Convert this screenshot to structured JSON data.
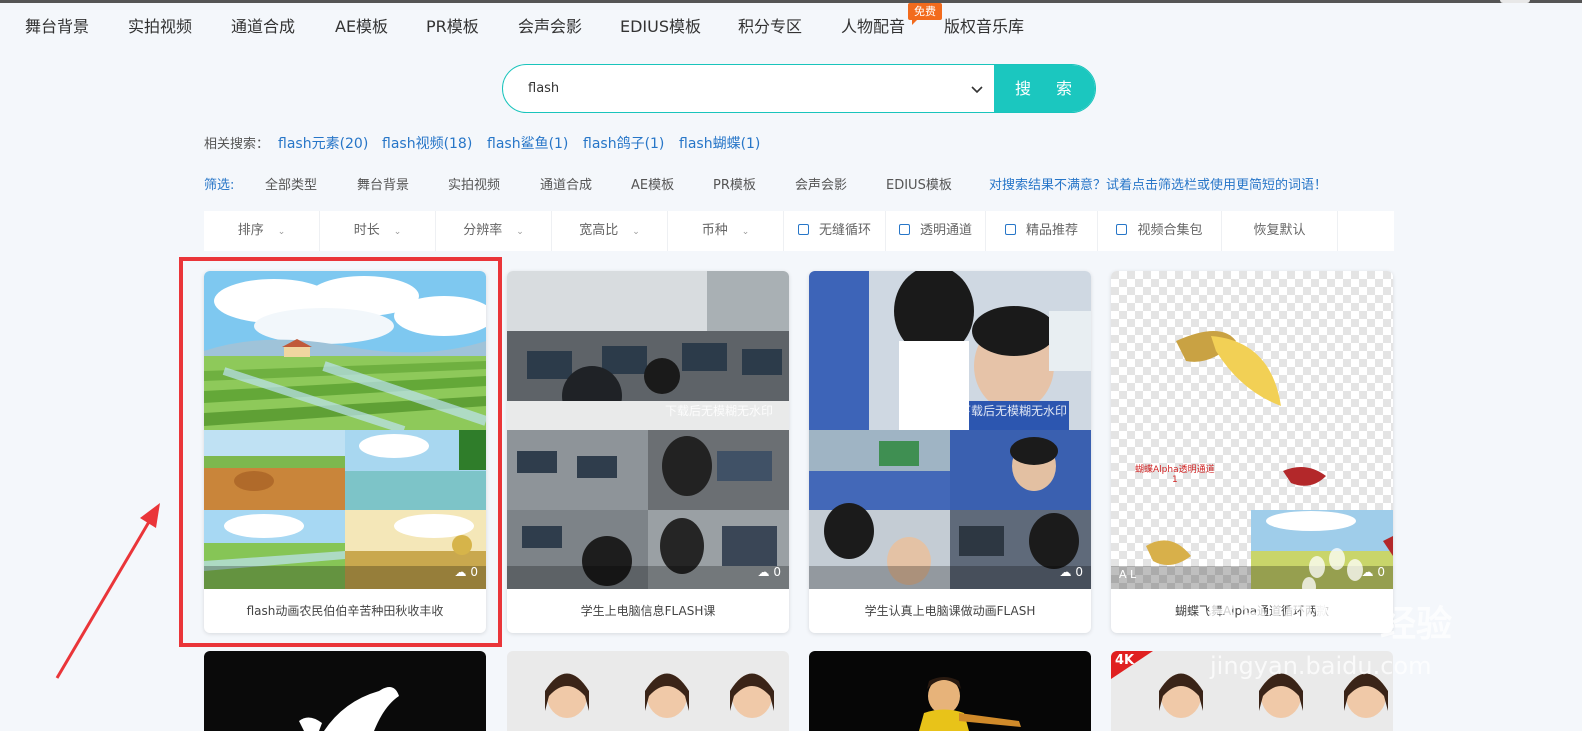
{
  "nav": {
    "items": [
      "舞台背景",
      "实拍视频",
      "通道合成",
      "AE模板",
      "PR模板",
      "会声会影",
      "EDIUS模板",
      "积分专区",
      "人物配音",
      "版权音乐库"
    ],
    "badge": "免费"
  },
  "search": {
    "value": "flash",
    "button_label": "搜 索"
  },
  "related": {
    "label": "相关搜索：",
    "links": [
      "flash元素(20)",
      "flash视频(18)",
      "flash鲨鱼(1)",
      "flash鸽子(1)",
      "flash蝴蝶(1)"
    ]
  },
  "filter": {
    "label": "筛选:",
    "items": [
      "全部类型",
      "舞台背景",
      "实拍视频",
      "通道合成",
      "AE模板",
      "PR模板",
      "会声会影",
      "EDIUS模板"
    ],
    "hint": "对搜索结果不满意？试着点击筛选栏或使用更简短的词语！"
  },
  "sortbar": {
    "dropdowns": [
      "排序",
      "时长",
      "分辨率",
      "宽高比",
      "币种"
    ],
    "checkboxes": [
      "无缝循环",
      "透明通道",
      "精品推荐",
      "视频合集包"
    ],
    "reset": "恢复默认"
  },
  "cards": [
    {
      "title": "flash动画农民伯伯辛苦种田秋收丰收",
      "downloads": "0"
    },
    {
      "title": "学生上电脑信息FLASH课",
      "downloads": "0",
      "watermark": "下载后无模糊无水印"
    },
    {
      "title": "学生认真上电脑课做动画FLASH",
      "downloads": "0",
      "watermark": "下载后无模糊无水印"
    },
    {
      "title": "蝴蝶飞舞Alpha通道循环两款",
      "downloads": "0",
      "overlay_text": "蝴蝶Alpha透明通道",
      "overlay_num": "1",
      "corner": "A  L"
    }
  ],
  "row2": {
    "badge_4k": "4K"
  },
  "watermark": {
    "brand": "Baidu",
    "brand_cn": "经验",
    "url": "jingyan.baidu.com"
  },
  "colors": {
    "accent": "#1bc7bf",
    "link": "#2776c8",
    "badge": "#f26b1d",
    "highlight": "#ea3539"
  }
}
